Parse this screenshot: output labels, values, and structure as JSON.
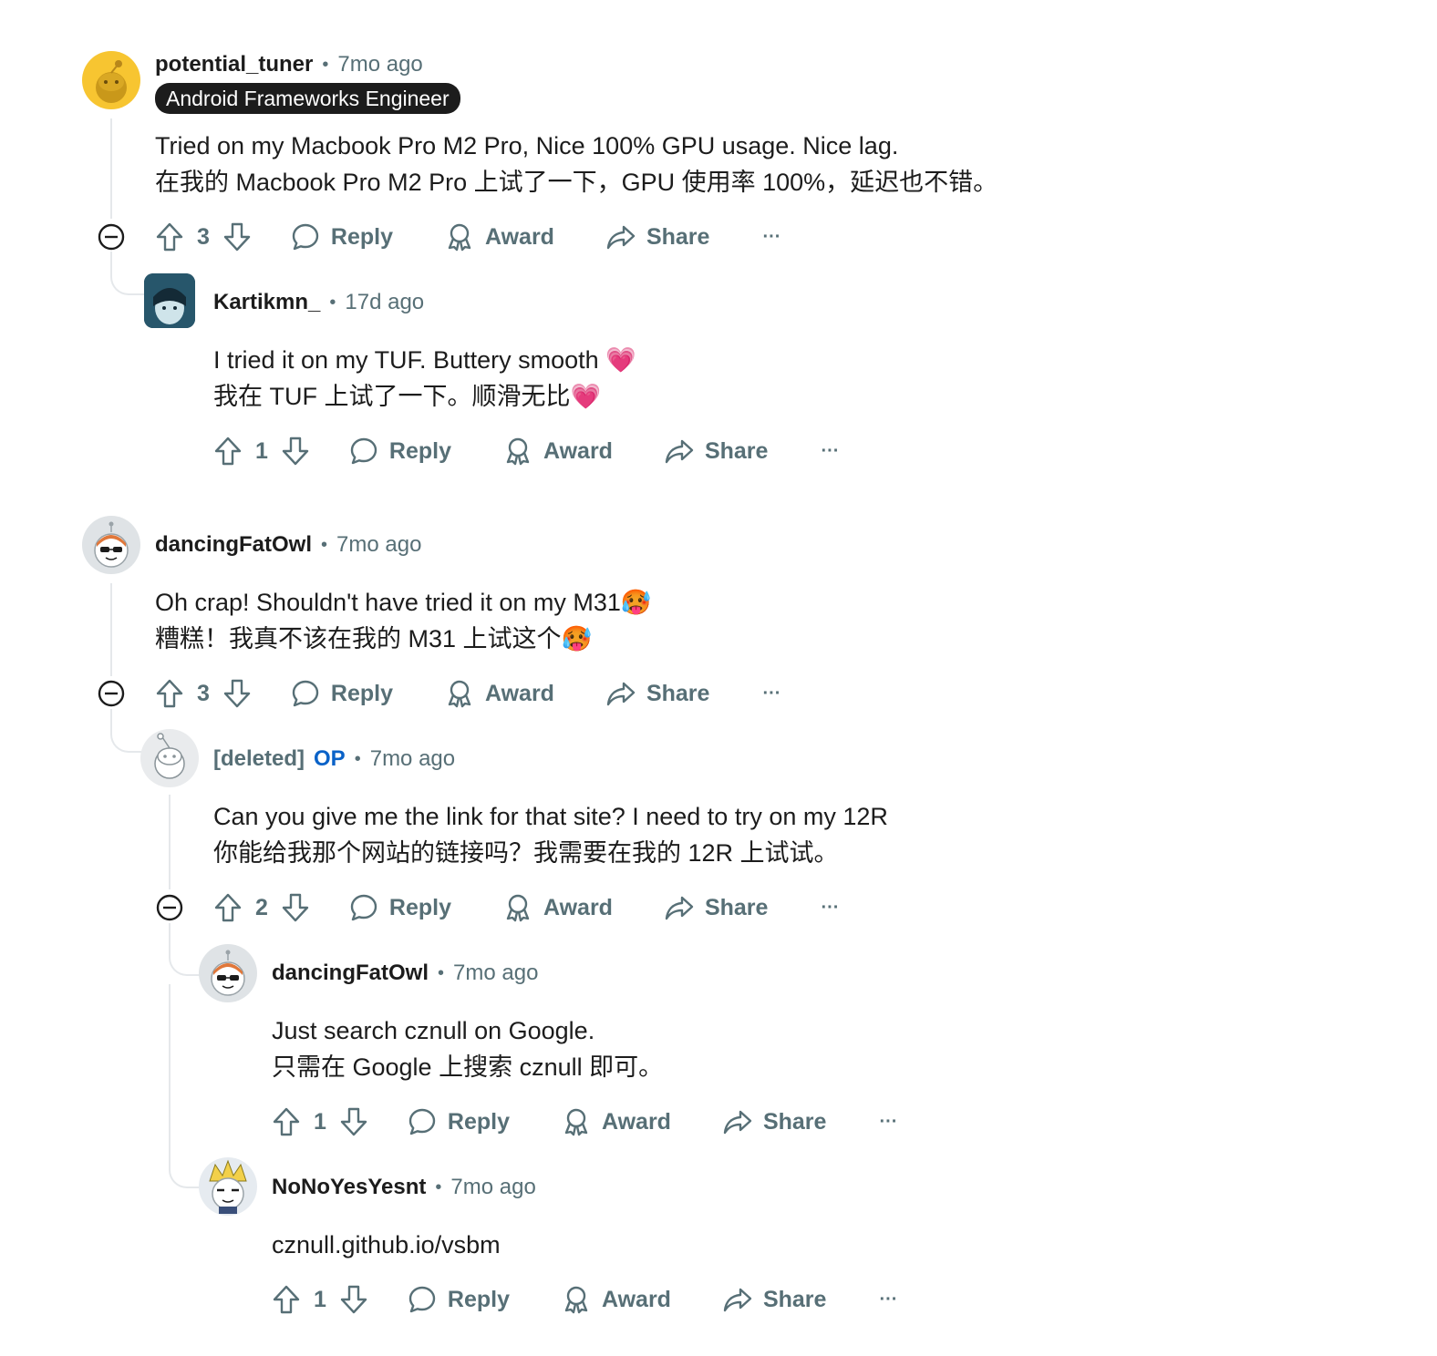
{
  "comments": [
    {
      "user": "potential_tuner",
      "time": "7mo ago",
      "flair": "Android Frameworks Engineer",
      "lines": [
        "Tried on my Macbook Pro M2 Pro, Nice 100% GPU usage. Nice lag.",
        "在我的 Macbook Pro M2 Pro 上试了一下，GPU 使用率 100%，延迟也不错。"
      ],
      "score": "3"
    },
    {
      "user": "Kartikmn_",
      "time": "17d ago",
      "lines": [
        "I tried it on my TUF. Buttery smooth 💗",
        "我在 TUF 上试了一下。顺滑无比💗"
      ],
      "score": "1"
    },
    {
      "user": "dancingFatOwl",
      "time": "7mo ago",
      "lines": [
        "Oh crap! Shouldn't have tried it on my M31🥵",
        "糟糕！我真不该在我的 M31 上试这个🥵"
      ],
      "score": "3"
    },
    {
      "user": "[deleted]",
      "op": "OP",
      "time": "7mo ago",
      "lines": [
        "Can you give me the link for that site? I need to try on my 12R",
        "你能给我那个网站的链接吗？我需要在我的 12R 上试试。"
      ],
      "score": "2"
    },
    {
      "user": "dancingFatOwl",
      "time": "7mo ago",
      "lines": [
        "Just search cznull on Google.",
        "只需在 Google 上搜索 cznull 即可。"
      ],
      "score": "1"
    },
    {
      "user": "NoNoYesYesnt",
      "time": "7mo ago",
      "lines": [
        "cznull.github.io/vsbm"
      ],
      "score": "1"
    }
  ],
  "labels": {
    "reply": "Reply",
    "award": "Award",
    "share": "Share",
    "more": "···",
    "dot": "•"
  },
  "colors": {
    "text": "#1c1c1c",
    "meta": "#576f76",
    "op": "#0a62c8",
    "thread": "#e5e8eb"
  }
}
